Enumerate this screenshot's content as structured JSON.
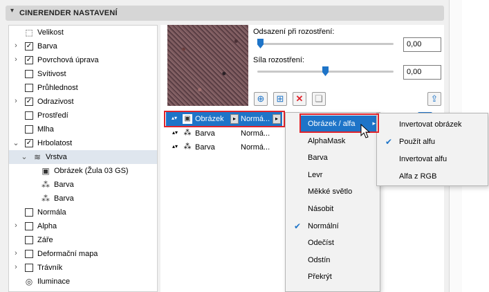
{
  "header": {
    "title": "CINERENDER NASTAVENÍ"
  },
  "tree": [
    {
      "label": "Velikost",
      "expander": "",
      "checkbox": null,
      "icon": "resize-icon",
      "icon_glyph": "⬚",
      "level": 0
    },
    {
      "label": "Barva",
      "expander": "›",
      "checkbox": true,
      "level": 0
    },
    {
      "label": "Povrchová úprava",
      "expander": "›",
      "checkbox": true,
      "level": 0
    },
    {
      "label": "Svítivost",
      "expander": "",
      "checkbox": false,
      "level": 0
    },
    {
      "label": "Průhlednost",
      "expander": "",
      "checkbox": false,
      "level": 0
    },
    {
      "label": "Odrazivost",
      "expander": "›",
      "checkbox": true,
      "level": 0
    },
    {
      "label": "Prostředí",
      "expander": "",
      "checkbox": false,
      "level": 0
    },
    {
      "label": "Mlha",
      "expander": "",
      "checkbox": false,
      "level": 0
    },
    {
      "label": "Hrbolatost",
      "expander": "⌄",
      "checkbox": true,
      "level": 0
    },
    {
      "label": "Vrstva",
      "expander": "⌄",
      "checkbox": null,
      "icon": "layers-icon",
      "icon_glyph": "≋",
      "level": 1,
      "selected": true
    },
    {
      "label": "Obrázek (Žula 03 GS)",
      "expander": "",
      "checkbox": null,
      "icon": "image-icon",
      "icon_glyph": "▣",
      "level": 2
    },
    {
      "label": "Barva",
      "expander": "",
      "checkbox": null,
      "icon": "color-circles-icon",
      "icon_glyph": "⁂",
      "level": 2
    },
    {
      "label": "Barva",
      "expander": "",
      "checkbox": null,
      "icon": "color-circles-icon",
      "icon_glyph": "⁂",
      "level": 2
    },
    {
      "label": "Normála",
      "expander": "",
      "checkbox": false,
      "level": 0
    },
    {
      "label": "Alpha",
      "expander": "›",
      "checkbox": false,
      "level": 0
    },
    {
      "label": "Záře",
      "expander": "",
      "checkbox": false,
      "level": 0
    },
    {
      "label": "Deformační mapa",
      "expander": "›",
      "checkbox": false,
      "level": 0
    },
    {
      "label": "Trávník",
      "expander": "›",
      "checkbox": false,
      "level": 0
    },
    {
      "label": "Iluminace",
      "expander": "",
      "checkbox": null,
      "icon": "illumination-icon",
      "icon_glyph": "◎",
      "level": 0
    }
  ],
  "sliders": {
    "offset": {
      "label": "Odsazení při rozostření:",
      "value": "0,00",
      "level": 0.0
    },
    "strength": {
      "label": "Síla rozostření:",
      "value": "0,00",
      "level": 0.5
    }
  },
  "toolbar": [
    {
      "name": "add-shader-button",
      "glyph": "⊕"
    },
    {
      "name": "add-layer-button",
      "glyph": "⊞"
    },
    {
      "name": "delete-button",
      "glyph": "✕"
    },
    {
      "name": "duplicate-button",
      "glyph": "❏"
    }
  ],
  "export_button": {
    "glyph": "⇪"
  },
  "layers": [
    {
      "name": "Obrázek",
      "mode": "Normá...",
      "icon": "image-icon",
      "glyph": "▣",
      "selected": true
    },
    {
      "name": "Barva",
      "mode": "Normá...",
      "icon": "color-circles-icon",
      "glyph": "⁂"
    },
    {
      "name": "Barva",
      "mode": "Normá...",
      "icon": "color-circles-icon",
      "glyph": "⁂"
    }
  ],
  "blend_menu": {
    "items": [
      {
        "label": "Obrázek / alfa",
        "highlighted": true,
        "submenu": true
      },
      {
        "label": "AlphaMask"
      },
      {
        "label": "Barva"
      },
      {
        "label": "Levr"
      },
      {
        "label": "Měkké světlo"
      },
      {
        "label": "Násobit"
      },
      {
        "label": "Normální",
        "checked": true
      },
      {
        "label": "Odečíst"
      },
      {
        "label": "Odstín"
      },
      {
        "label": "Překrýt"
      }
    ]
  },
  "alpha_submenu": {
    "items": [
      {
        "label": "Invertovat obrázek"
      },
      {
        "label": "Použít alfu",
        "checked": true
      },
      {
        "label": "Invertovat alfu"
      },
      {
        "label": "Alfa z RGB"
      }
    ]
  },
  "colors": {
    "accent": "#1e74c8",
    "highlight_box": "#e0232b",
    "delete": "#e0232b"
  }
}
